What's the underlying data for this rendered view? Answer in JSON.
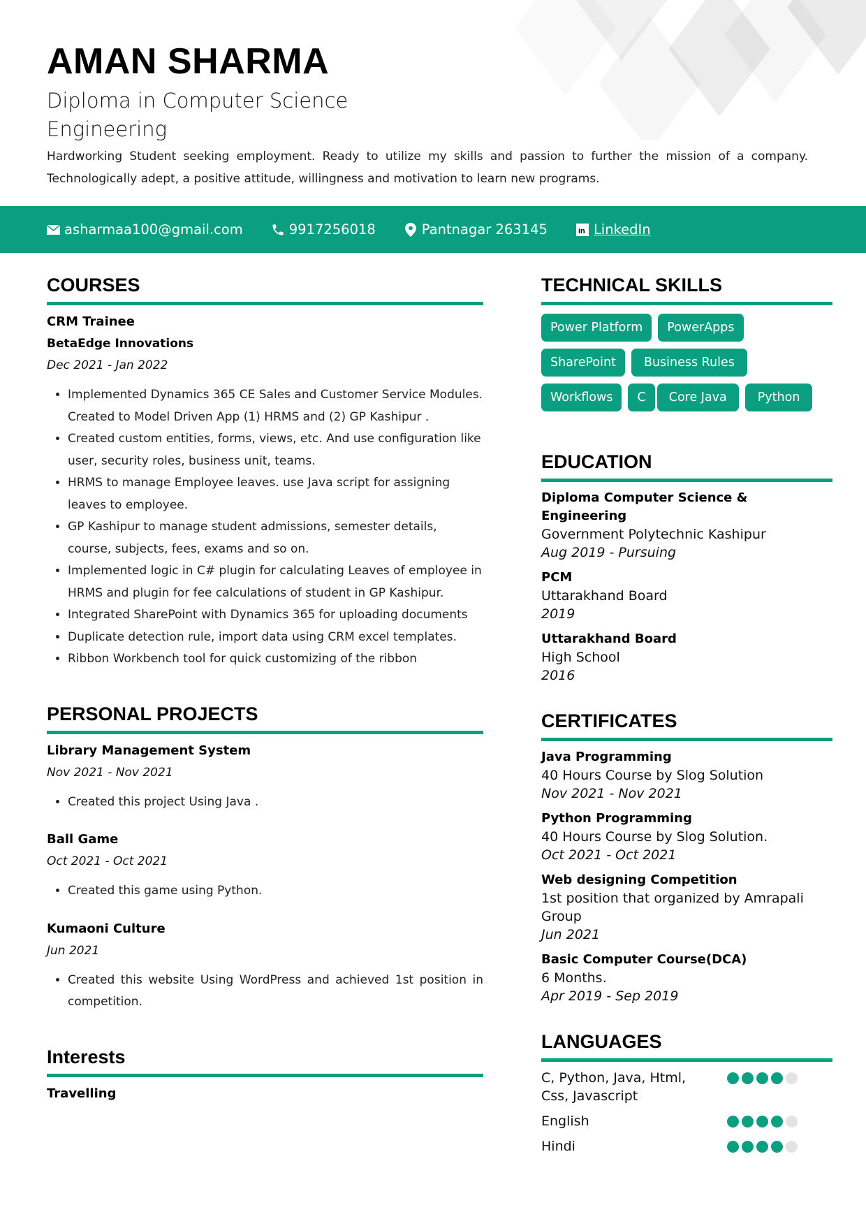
{
  "header": {
    "name": "AMAN SHARMA",
    "headline": "Diploma in Computer Science Engineering",
    "summary": "Hardworking Student seeking employment. Ready to utilize my skills and passion to further the mission of a company. Technologically adept, a positive attitude, willingness and motivation to learn new programs."
  },
  "theme": {
    "accent": "#0a9f80",
    "dot_inactive": "#e3e3e3"
  },
  "contact": {
    "email": {
      "icon": "mail-icon",
      "text": "asharmaa100@gmail.com"
    },
    "phone": {
      "icon": "phone-icon",
      "text": "9917256018"
    },
    "location": {
      "icon": "location-pin-icon",
      "text": "Pantnagar 263145"
    },
    "linkedin": {
      "icon": "linkedin-icon",
      "text": "LinkedIn"
    }
  },
  "courses": {
    "title": "COURSES",
    "items": [
      {
        "title": "CRM Trainee",
        "org": "BetaEdge Innovations",
        "date": "Dec 2021 - Jan 2022",
        "bullets": [
          "Implemented Dynamics 365 CE Sales and Customer Service Modules. Created to Model Driven App (1) HRMS and (2) GP Kashipur .",
          "Created custom entities, forms, views, etc. And use configuration like user, security roles, business unit, teams.",
          "HRMS to manage Employee leaves. use Java script for assigning leaves to employee.",
          "GP Kashipur to manage student admissions, semester details, course, subjects, fees, exams and so on.",
          "Implemented logic in C# plugin for calculating Leaves of employee in HRMS and plugin for fee calculations of student in GP Kashipur.",
          "Integrated SharePoint with Dynamics 365 for uploading documents",
          "Duplicate detection rule, import data using CRM excel templates.",
          "Ribbon Workbench tool for quick customizing of the ribbon"
        ]
      }
    ]
  },
  "projects": {
    "title": "PERSONAL PROJECTS",
    "items": [
      {
        "title": "Library Management System",
        "date": "Nov 2021 - Nov 2021",
        "bullets": [
          "Created this project Using Java ."
        ]
      },
      {
        "title": "Ball Game",
        "date": "Oct 2021 - Oct 2021",
        "bullets": [
          "Created this game using Python."
        ]
      },
      {
        "title": "Kumaoni Culture",
        "date": "Jun 2021",
        "bullets": [
          "Created this website Using WordPress and achieved 1st position in competition."
        ]
      }
    ]
  },
  "interests": {
    "title": "Interests",
    "items": [
      "Travelling"
    ]
  },
  "skills": {
    "title": "TECHNICAL SKILLS",
    "items": [
      "Power Platform",
      "PowerApps",
      "SharePoint",
      "Business Rules",
      "Workflows",
      "C",
      "Core Java",
      "Python"
    ]
  },
  "education": {
    "title": "EDUCATION",
    "items": [
      {
        "title": "Diploma Computer Science & Engineering",
        "place": "Government Polytechnic Kashipur",
        "date": "Aug 2019 - Pursuing"
      },
      {
        "title": "PCM",
        "place": "Uttarakhand Board",
        "date": "2019"
      },
      {
        "title": "Uttarakhand Board",
        "place": "High School",
        "date": "2016"
      }
    ]
  },
  "certificates": {
    "title": "CERTIFICATES",
    "items": [
      {
        "title": "Java Programming",
        "desc": "40 Hours Course by Slog Solution",
        "date": "Nov 2021 - Nov 2021"
      },
      {
        "title": "Python Programming",
        "desc": "40 Hours Course by Slog Solution.",
        "date": "Oct 2021 - Oct 2021"
      },
      {
        "title": "Web designing Competition",
        "desc": "1st position that organized by Amrapali Group",
        "date": "Jun 2021"
      },
      {
        "title": "Basic Computer Course(DCA)",
        "desc": "6 Months.",
        "date": "Apr 2019 - Sep 2019"
      }
    ]
  },
  "languages": {
    "title": "LANGUAGES",
    "items": [
      {
        "name": "C, Python, Java, Html, Css, Javascript",
        "level": 4,
        "max": 5
      },
      {
        "name": "English",
        "level": 4,
        "max": 5
      },
      {
        "name": "Hindi",
        "level": 4,
        "max": 5
      }
    ]
  }
}
